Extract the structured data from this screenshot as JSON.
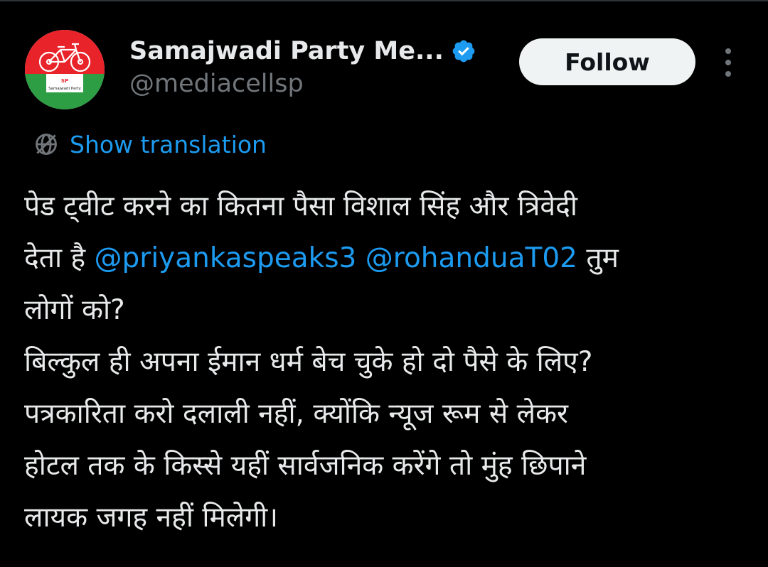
{
  "author": {
    "display_name": "Samajwadi Party Me...",
    "handle": "@mediacellsp",
    "verified": true,
    "avatar": {
      "icon": "samajwadi-party-logo",
      "logo_text_top": "SP",
      "logo_text_bottom": "Samajwadi Party"
    }
  },
  "actions": {
    "follow_label": "Follow",
    "more_icon": "more-vertical-icon"
  },
  "translation": {
    "icon": "globe-icon",
    "label": "Show translation"
  },
  "tweet": {
    "line1": "पेड ट्वीट करने का कितना पैसा विशाल सिंह और त्रिवेदी",
    "line2_prefix": "देता है ",
    "mention1": "@priyankaspeaks3",
    "line2_space": " ",
    "mention2": "@rohanduaT02",
    "line2_suffix": " तुम",
    "line3": "लोगों को?",
    "line4": "बिल्कुल ही अपना ईमान धर्म बेच चुके हो दो पैसे के लिए?",
    "line5": "पत्रकारिता करो दलाली नहीं, क्योंकि न्यूज रूम से लेकर",
    "line6": "होटल तक के किस्से यहीं सार्वजनिक करेंगे तो मुंह छिपाने",
    "line7": "लायक जगह नहीं मिलेगी।"
  },
  "colors": {
    "background": "#000000",
    "text": "#e7e9ea",
    "secondary_text": "#71767b",
    "link": "#1d9bf0",
    "follow_button_bg": "#eff3f4",
    "verified_badge": "#1d9bf0",
    "logo_red": "#e8232a",
    "logo_green": "#2e9e44"
  }
}
